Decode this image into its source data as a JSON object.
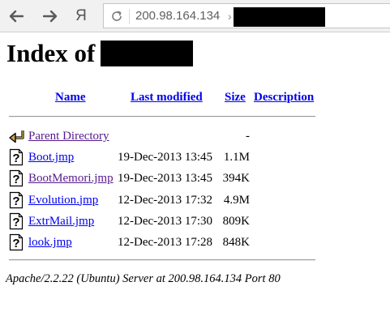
{
  "browser": {
    "url": "200.98.164.134",
    "url_separator": "›",
    "yandex_label": "Я",
    "icons": {
      "back": "arrow-left-icon",
      "forward": "arrow-right-icon",
      "reload": "reload-icon"
    }
  },
  "page": {
    "title": "Index of",
    "columns": {
      "name": "Name",
      "last_modified": "Last modified",
      "size": "Size",
      "description": "Description"
    },
    "parent": {
      "label": "Parent Directory",
      "size": "-"
    },
    "files": [
      {
        "name": "Boot.jmp",
        "modified": "19-Dec-2013 13:45",
        "size": "1.1M",
        "visited": false
      },
      {
        "name": "BootMemori.jmp",
        "modified": "19-Dec-2013 13:45",
        "size": "394K",
        "visited": true
      },
      {
        "name": "Evolution.jmp",
        "modified": "12-Dec-2013 17:32",
        "size": "4.9M",
        "visited": false
      },
      {
        "name": "ExtrMail.jmp",
        "modified": "12-Dec-2013 17:30",
        "size": "809K",
        "visited": false
      },
      {
        "name": "look.jmp",
        "modified": "12-Dec-2013 17:28",
        "size": "848K",
        "visited": false
      }
    ],
    "footer": "Apache/2.2.22 (Ubuntu) Server at 200.98.164.134 Port 80"
  },
  "colors": {
    "link": "#0000ee",
    "visited_link": "#551a8b",
    "redaction": "#000000"
  }
}
